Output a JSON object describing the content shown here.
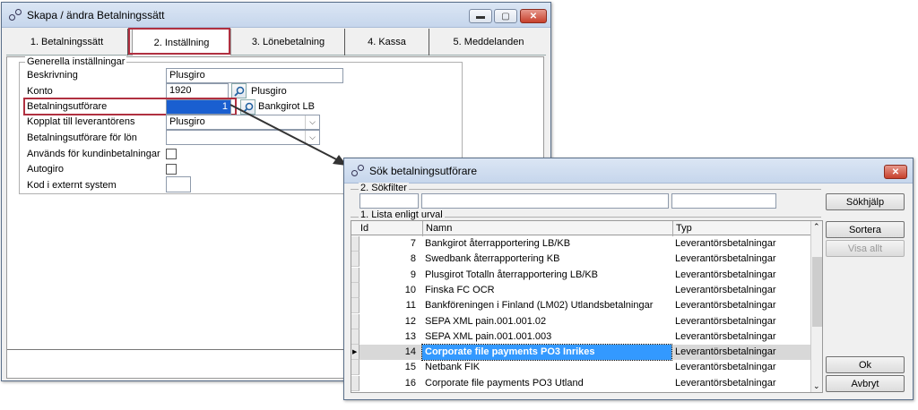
{
  "main_window": {
    "title": "Skapa / ändra Betalningssätt",
    "tabs": [
      {
        "label": "1. Betalningssätt"
      },
      {
        "label": "2. Inställning"
      },
      {
        "label": "3. Lönebetalning"
      },
      {
        "label": "4. Kassa"
      },
      {
        "label": "5. Meddelanden"
      }
    ],
    "group_title": "Generella inställningar",
    "fields": {
      "beskrivning_label": "Beskrivning",
      "beskrivning_value": "Plusgiro",
      "konto_label": "Konto",
      "konto_value": "1920",
      "konto_desc": "Plusgiro",
      "utforare_label": "Betalningsutförare",
      "utforare_value": "1",
      "utforare_desc": "Bankgirot LB",
      "kopplat_label": "Kopplat till leverantörens",
      "kopplat_value": "Plusgiro",
      "lon_label": "Betalningsutförare för lön",
      "lon_value": "",
      "kund_label": "Används för kundinbetalningar",
      "autogiro_label": "Autogiro",
      "kod_label": "Kod i externt system"
    }
  },
  "dialog": {
    "title": "Sök betalningsutförare",
    "filter_title": "2. Sökfilter",
    "list_title": "1. Lista enligt urval",
    "buttons": {
      "sokhjalp": "Sökhjälp",
      "sortera": "Sortera",
      "visa_allt": "Visa allt",
      "ok": "Ok",
      "avbryt": "Avbryt"
    },
    "columns": {
      "id": "Id",
      "namn": "Namn",
      "typ": "Typ"
    },
    "rows": [
      {
        "id": "7",
        "namn": "Bankgirot återrapportering LB/KB",
        "typ": "Leverantörsbetalningar"
      },
      {
        "id": "8",
        "namn": "Swedbank återrapportering KB",
        "typ": "Leverantörsbetalningar"
      },
      {
        "id": "9",
        "namn": "Plusgirot Totalln återrapportering LB/KB",
        "typ": "Leverantörsbetalningar"
      },
      {
        "id": "10",
        "namn": "Finska FC OCR",
        "typ": "Leverantörsbetalningar"
      },
      {
        "id": "11",
        "namn": "Bankföreningen i Finland (LM02) Utlandsbetalningar",
        "typ": "Leverantörsbetalningar"
      },
      {
        "id": "12",
        "namn": "SEPA XML pain.001.001.02",
        "typ": "Leverantörsbetalningar"
      },
      {
        "id": "13",
        "namn": "SEPA XML pain.001.001.003",
        "typ": "Leverantörsbetalningar"
      },
      {
        "id": "14",
        "namn": "Corporate file payments PO3 Inrikes",
        "typ": "Leverantörsbetalningar"
      },
      {
        "id": "15",
        "namn": "Netbank FIK",
        "typ": "Leverantörsbetalningar"
      },
      {
        "id": "16",
        "namn": "Corporate file payments PO3 Utland",
        "typ": "Leverantörsbetalningar"
      }
    ],
    "selected_id": "14"
  },
  "colors": {
    "highlight": "#b03040",
    "selection": "#3399ff"
  }
}
